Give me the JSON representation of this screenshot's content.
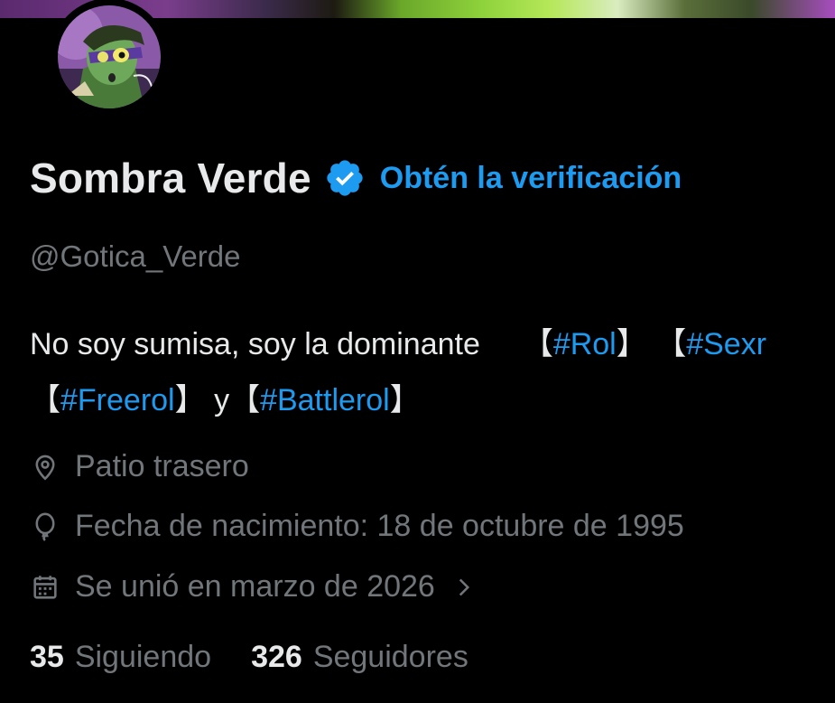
{
  "profile": {
    "display_name": "Sombra Verde",
    "get_verified_label": "Obtén la verificación",
    "handle": "@Gotica_Verde",
    "bio": {
      "line1_text": "No soy sumisa, soy la dominante",
      "tags": [
        "#Rol",
        "#Sexr",
        "#Freerol",
        "#Battlerol"
      ],
      "conjunction": "y"
    },
    "location": "Patio trasero",
    "birthdate": "Fecha de nacimiento: 18 de octubre de 1995",
    "joined": "Se unió en marzo de 2026"
  },
  "stats": {
    "following_count": "35",
    "following_label": "Siguiendo",
    "followers_count": "326",
    "followers_label": "Seguidores"
  },
  "icons": {
    "verified": "verified-badge-icon",
    "location": "location-pin-icon",
    "birthday": "balloon-icon",
    "joined": "calendar-icon",
    "joined_chevron": "chevron-right-icon"
  },
  "colors": {
    "background": "#000000",
    "text_primary": "#e7e9ea",
    "text_secondary": "#71767b",
    "accent": "#1d9bf0"
  }
}
